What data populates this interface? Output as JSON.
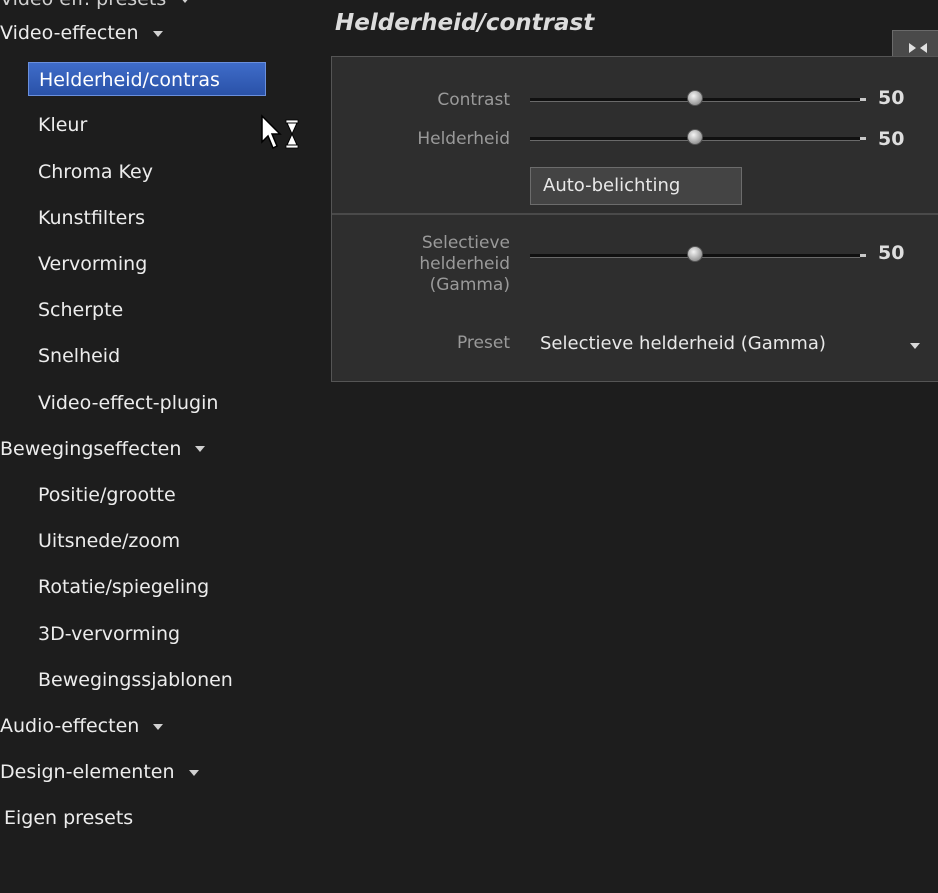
{
  "sidebar": {
    "partial_top": "Video eff. presets",
    "items": [
      {
        "label": "Video-effecten",
        "type": "category"
      },
      {
        "label": "Helderheid/contras",
        "type": "sub",
        "selected": true
      },
      {
        "label": "Kleur",
        "type": "sub"
      },
      {
        "label": "Chroma Key",
        "type": "sub"
      },
      {
        "label": "Kunstfilters",
        "type": "sub"
      },
      {
        "label": "Vervorming",
        "type": "sub"
      },
      {
        "label": "Scherpte",
        "type": "sub"
      },
      {
        "label": "Snelheid",
        "type": "sub"
      },
      {
        "label": "Video-effect-plugin",
        "type": "sub"
      },
      {
        "label": "Bewegingseffecten",
        "type": "category"
      },
      {
        "label": "Positie/grootte",
        "type": "sub"
      },
      {
        "label": "Uitsnede/zoom",
        "type": "sub"
      },
      {
        "label": "Rotatie/spiegeling",
        "type": "sub"
      },
      {
        "label": "3D-vervorming",
        "type": "sub"
      },
      {
        "label": "Bewegingssjablonen",
        "type": "sub"
      },
      {
        "label": "Audio-effecten",
        "type": "category"
      },
      {
        "label": "Design-elementen",
        "type": "category"
      },
      {
        "label": "Eigen presets",
        "type": "category-nocaret"
      }
    ]
  },
  "panel": {
    "title": "Helderheid/contrast",
    "contrast": {
      "label": "Contrast",
      "value": "50",
      "level": 0.5
    },
    "brightness": {
      "label": "Helderheid",
      "value": "50",
      "level": 0.5
    },
    "auto_button": "Auto-belichting",
    "gamma": {
      "label_lines": [
        "Selectieve",
        "helderheid",
        "(Gamma)"
      ],
      "value": "50",
      "level": 0.5
    },
    "preset": {
      "label": "Preset",
      "value": "Selectieve helderheid (Gamma)"
    }
  },
  "colors": {
    "selection": "#3a62c0",
    "background": "#1d1d1d",
    "panel": "#2e2e2e"
  }
}
